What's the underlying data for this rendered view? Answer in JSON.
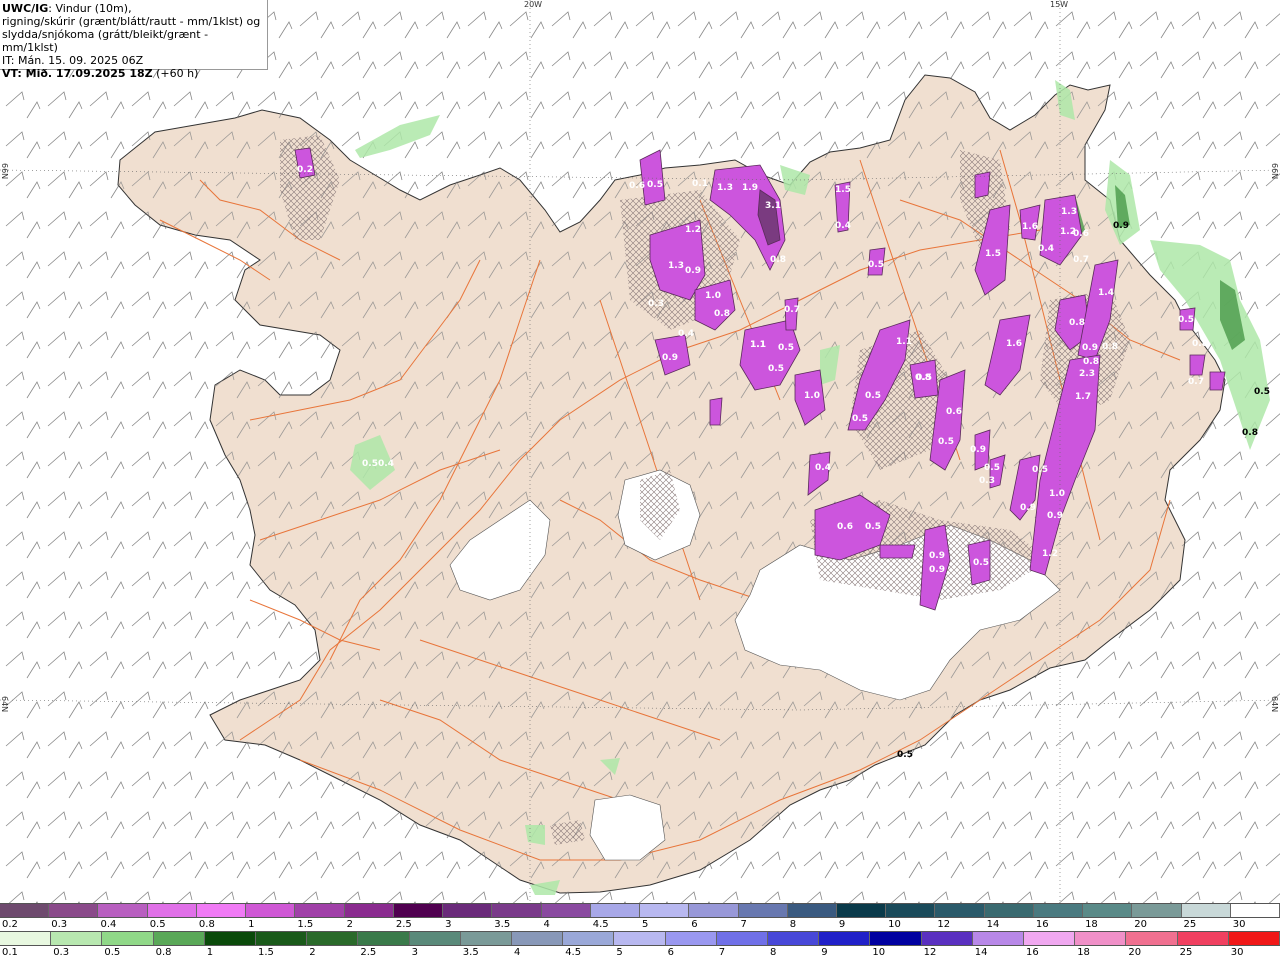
{
  "header": {
    "title_bold": "UWC/IG",
    "title_rest": ": Vindur (10m),",
    "line2": "rigning/skúrir (grænt/blátt/rautt - mm/1klst) og",
    "line3": "slydda/snjókoma (grátt/bleikt/grænt - mm/1klst)",
    "line4": "IT: Mán. 15. 09. 2025 06Z",
    "line5_bold": "VT: Mið. 17.09.2025 18Z",
    "line5_rest": " (+60 h)"
  },
  "grid_labels": {
    "lon_20w": "20W",
    "lon_15w": "15W",
    "lat_66n_left": "66N",
    "lat_66n_right": "66N",
    "lat_64n_left": "64N",
    "lat_64n_right": "64N"
  },
  "colors": {
    "land": "#f0dfd0",
    "roads": "#e8753a",
    "glacier": "#ffffff",
    "snow_purple": "#cc55dd",
    "snow_dark": "#7a3b80",
    "rain_green": "#aee8a8",
    "wind_barb": "#777777"
  },
  "precip_labels": [
    {
      "text": "0.2"
    },
    {
      "text": "0.6"
    },
    {
      "text": "0.5"
    },
    {
      "text": "0.1"
    },
    {
      "text": "1.3"
    },
    {
      "text": "1.9"
    },
    {
      "text": "3.1"
    },
    {
      "text": "0.8"
    },
    {
      "text": "1.5"
    },
    {
      "text": "0.4"
    },
    {
      "text": "0.5"
    },
    {
      "text": "1.2"
    },
    {
      "text": "1.3"
    },
    {
      "text": "0.9"
    },
    {
      "text": "0.3"
    },
    {
      "text": "1.0"
    },
    {
      "text": "0.8"
    },
    {
      "text": "0.9"
    },
    {
      "text": "0.4"
    },
    {
      "text": "0.7"
    },
    {
      "text": "1.1"
    },
    {
      "text": "0.5"
    },
    {
      "text": "0.5"
    },
    {
      "text": "1.0"
    },
    {
      "text": "1.1"
    },
    {
      "text": "0.5"
    },
    {
      "text": "0.5"
    },
    {
      "text": "0.8"
    },
    {
      "text": "0.6"
    },
    {
      "text": "0.5"
    },
    {
      "text": "0.4"
    },
    {
      "text": "0.5"
    },
    {
      "text": "0.9"
    },
    {
      "text": "0.9"
    },
    {
      "text": "0.5"
    },
    {
      "text": "1.5"
    },
    {
      "text": "1.6"
    },
    {
      "text": "1.3"
    },
    {
      "text": "1.2"
    },
    {
      "text": "0.4"
    },
    {
      "text": "0.6"
    },
    {
      "text": "0.7"
    },
    {
      "text": "0.9"
    },
    {
      "text": "1.4"
    },
    {
      "text": "0.8"
    },
    {
      "text": "0.9"
    },
    {
      "text": "0.8"
    },
    {
      "text": "2.3"
    },
    {
      "text": "1.7"
    },
    {
      "text": "0.5"
    },
    {
      "text": "1.0"
    },
    {
      "text": "0.9"
    },
    {
      "text": "0.9"
    },
    {
      "text": "1.2"
    },
    {
      "text": "0.9"
    },
    {
      "text": "0.5"
    },
    {
      "text": "0.3"
    },
    {
      "text": "0.6"
    },
    {
      "text": "1.6"
    },
    {
      "text": "0.5"
    },
    {
      "text": "1.1"
    },
    {
      "text": "0.8"
    },
    {
      "text": "0.5"
    },
    {
      "text": "0.8"
    },
    {
      "text": "0.7"
    },
    {
      "text": "0.5"
    },
    {
      "text": "0.8"
    },
    {
      "text": "0.5"
    },
    {
      "text": "0.5"
    },
    {
      "text": "0.4"
    }
  ],
  "legend_snow": {
    "labels": [
      "0.2",
      "0.3",
      "0.4",
      "0.5",
      "0.8",
      "1",
      "1.5",
      "2",
      "2.5",
      "3",
      "3.5",
      "4",
      "4.5",
      "5",
      "6",
      "7",
      "8",
      "9",
      "10",
      "12",
      "14",
      "16",
      "18",
      "20",
      "25",
      "30"
    ],
    "colors": [
      "#6e4a6e",
      "#8a4a8a",
      "#b85fc0",
      "#e070e8",
      "#f07af5",
      "#cf58d5",
      "#a040a8",
      "#8a2b8f",
      "#500050",
      "#6a2a7a",
      "#7a3a8a",
      "#8a4aa0",
      "#a8a8e8",
      "#b8b8f0",
      "#9898d8",
      "#6878b0",
      "#3a5a80",
      "#0a3a4a",
      "#1a4a5a",
      "#2a5a6a",
      "#3a6a70",
      "#4a7a80",
      "#5a8a88",
      "#7a9a98",
      "#c8d8d8",
      "#ffffff"
    ]
  },
  "legend_rain": {
    "labels": [
      "0.1",
      "0.3",
      "0.5",
      "0.8",
      "1",
      "1.5",
      "2",
      "2.5",
      "3",
      "3.5",
      "4",
      "4.5",
      "5",
      "6",
      "7",
      "8",
      "9",
      "10",
      "12",
      "14",
      "16",
      "18",
      "20",
      "25",
      "30"
    ],
    "colors": [
      "#e8f8e0",
      "#b8e8b0",
      "#90d888",
      "#5aa858",
      "#0a4a0a",
      "#1a5a1a",
      "#2a6a2a",
      "#3a7a4a",
      "#5a8a7a",
      "#7a9a98",
      "#8898b8",
      "#9aa8d8",
      "#b8b8f0",
      "#9a98f0",
      "#7070e8",
      "#4848d8",
      "#2020c8",
      "#0000a0",
      "#5a30c0",
      "#b888e8",
      "#f0a8f0",
      "#f090c8",
      "#f07090",
      "#f04060",
      "#f01818"
    ]
  }
}
